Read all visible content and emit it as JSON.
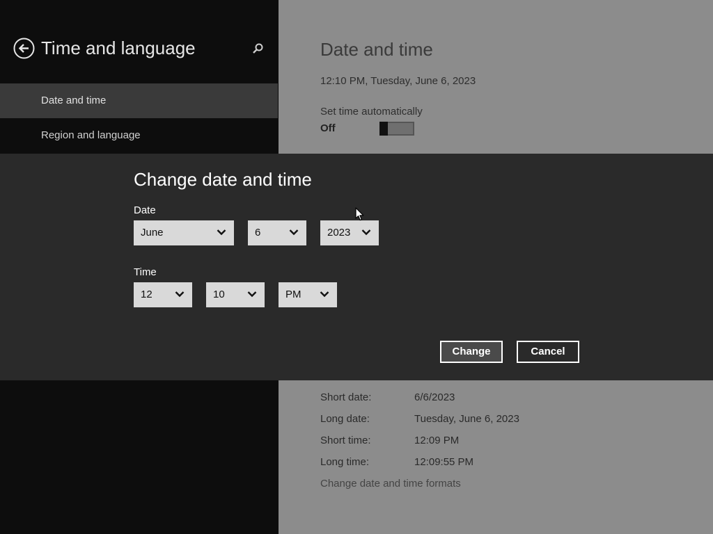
{
  "left_pane": {
    "title": "Time and language",
    "icons": {
      "back": "back-arrow-circle-icon",
      "search": "search-icon"
    },
    "nav_items": [
      {
        "label": "Date and time",
        "selected": true
      },
      {
        "label": "Region and language",
        "selected": false
      }
    ]
  },
  "main": {
    "title": "Date and time",
    "current_datetime": "12:10 PM, Tuesday, June 6, 2023",
    "set_time_automatically": {
      "label": "Set time automatically",
      "state": "Off"
    },
    "formats": [
      {
        "label": "Short date:",
        "value": "6/6/2023"
      },
      {
        "label": "Long date:",
        "value": "Tuesday, June 6, 2023"
      },
      {
        "label": "Short time:",
        "value": "12:09 PM"
      },
      {
        "label": "Long time:",
        "value": "12:09:55 PM"
      }
    ],
    "change_formats_link": "Change date and time formats"
  },
  "dialog": {
    "title": "Change date and time",
    "date_label": "Date",
    "date": {
      "month": "June",
      "day": "6",
      "year": "2023"
    },
    "time_label": "Time",
    "time": {
      "hour": "12",
      "minute": "10",
      "ampm": "PM"
    },
    "change_button": "Change",
    "cancel_button": "Cancel"
  },
  "colors": {
    "dialog_bg": "#2a2a2a",
    "left_pane_bg": "#0d0d0d",
    "selected_nav_bg": "#3a3a3a",
    "dimmed_content_bg": "#8c8c8c",
    "dropdown_bg": "#d9d9d9"
  }
}
